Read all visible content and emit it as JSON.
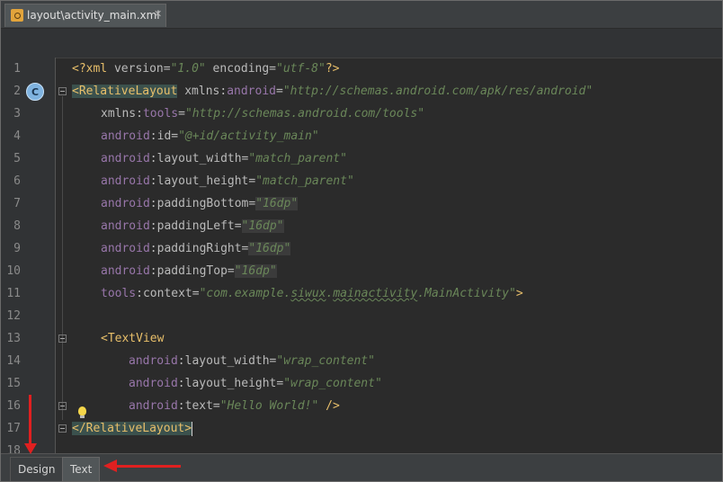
{
  "tab": {
    "title": "layout\\activity_main.xml",
    "close_glyph": "✕",
    "icon": "xml-file-icon"
  },
  "gutter": {
    "line_numbers": [
      "1",
      "2",
      "3",
      "4",
      "5",
      "6",
      "7",
      "8",
      "9",
      "10",
      "11",
      "12",
      "13",
      "14",
      "15",
      "16",
      "17",
      "18"
    ],
    "class_badge": "C",
    "bulb_icon": "lightbulb-icon"
  },
  "code": {
    "line1": {
      "open": "<?",
      "name": "xml",
      "p1": " version=",
      "v1": "\"1.0\"",
      "p2": " encoding=",
      "v2": "\"utf-8\"",
      "close": "?>"
    },
    "line2": {
      "tag": "<RelativeLayout",
      "attr_prefix": " xmlns",
      "colon": ":",
      "ns": "android",
      "eq": "=",
      "value": "\"http://schemas.android.com/apk/res/android\""
    },
    "line3": {
      "prefix": "xmlns",
      "colon": ":",
      "name": "tools",
      "eq": "=",
      "value": "\"http://schemas.android.com/tools\""
    },
    "line4": {
      "ns": "android",
      "name": ":id=",
      "value": "\"@+id/activity_main\""
    },
    "line5": {
      "ns": "android",
      "name": ":layout_width=",
      "value": "\"match_parent\""
    },
    "line6": {
      "ns": "android",
      "name": ":layout_height=",
      "value": "\"match_parent\""
    },
    "line7": {
      "ns": "android",
      "name": ":paddingBottom=",
      "value": "\"16dp\""
    },
    "line8": {
      "ns": "android",
      "name": ":paddingLeft=",
      "value": "\"16dp\""
    },
    "line9": {
      "ns": "android",
      "name": ":paddingRight=",
      "value": "\"16dp\""
    },
    "line10": {
      "ns": "android",
      "name": ":paddingTop=",
      "value": "\"16dp\""
    },
    "line11": {
      "ns": "tools",
      "name": ":context=",
      "value_a": "\"com.example.",
      "value_b": "siwux",
      "value_c": ".",
      "value_d": "mainactivity",
      "value_e": ".MainActivity\"",
      "close": ">"
    },
    "line13": {
      "tag": "<TextView"
    },
    "line14": {
      "ns": "android",
      "name": ":layout_width=",
      "value": "\"wrap_content\""
    },
    "line15": {
      "ns": "android",
      "name": ":layout_height=",
      "value": "\"wrap_content\""
    },
    "line16": {
      "ns": "android",
      "name": ":text=",
      "value": "\"Hello World!\"",
      "close": " />"
    },
    "line17": {
      "tag": "</RelativeLayout>"
    }
  },
  "bottom_tabs": {
    "design": "Design",
    "text": "Text",
    "selected": "Text"
  },
  "colors": {
    "background": "#2b2b2b",
    "tag": "#e8bf6a",
    "namespace": "#9876aa",
    "string": "#6a8759",
    "annotation_arrow": "#e02020"
  }
}
